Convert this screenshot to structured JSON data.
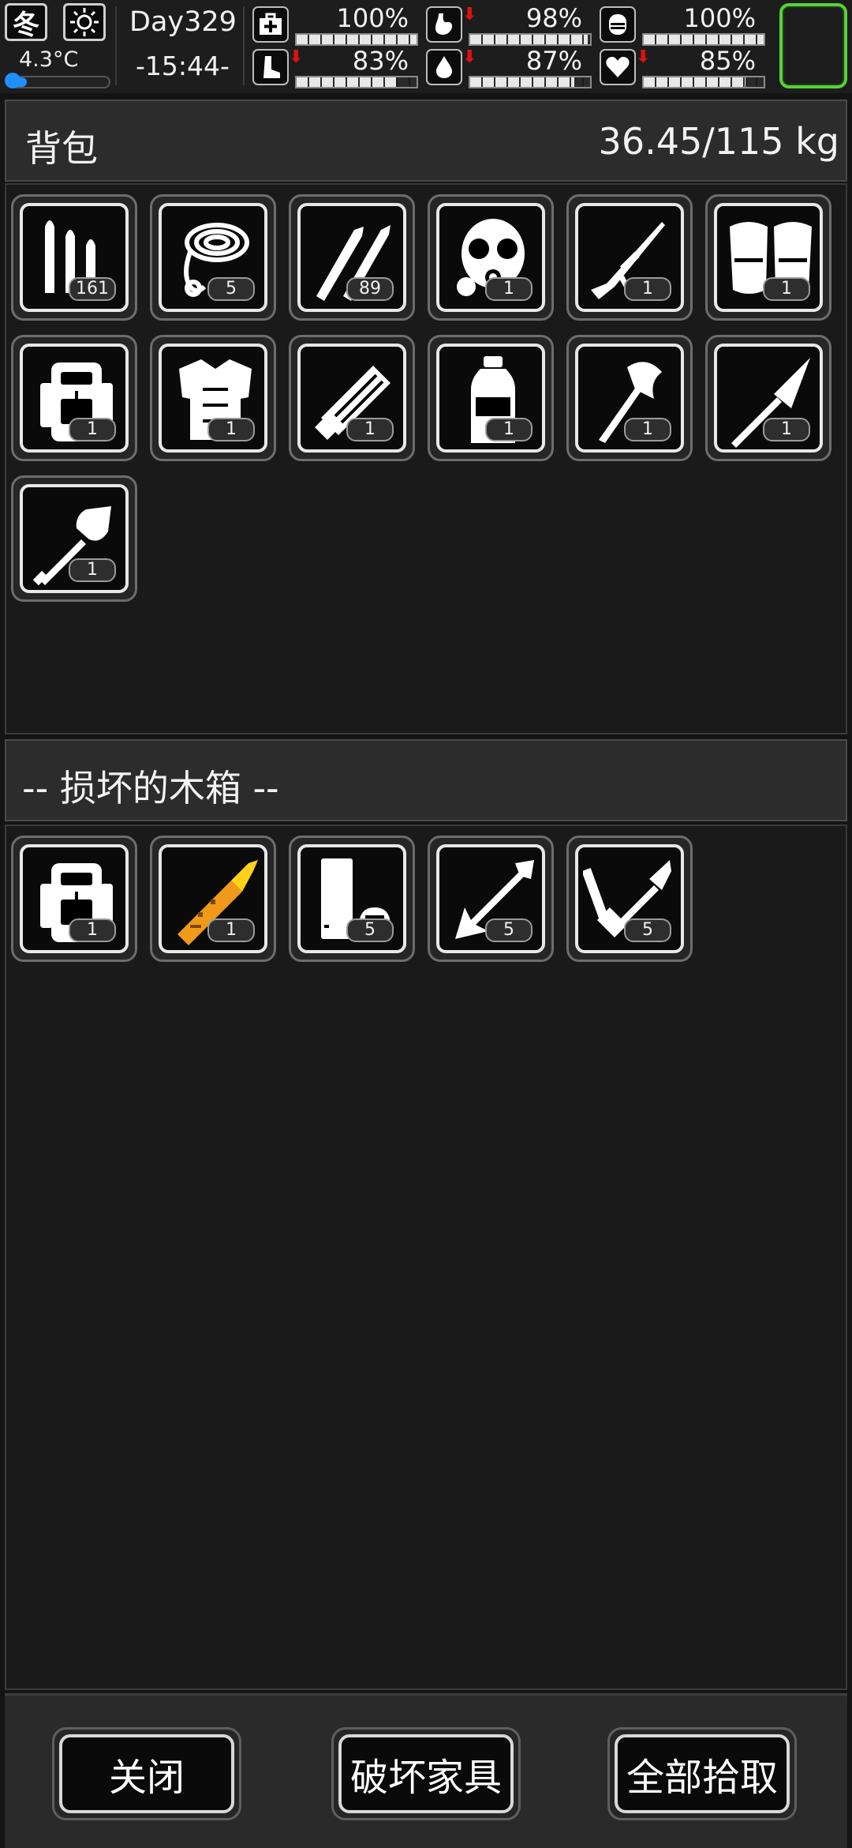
{
  "status": {
    "season": "冬",
    "weather_icon": "sun-icon",
    "temperature": "4.3°C",
    "temperature_level": 0.15,
    "day": "Day329",
    "time": "-15:44-",
    "stats": [
      {
        "icon": "medkit-icon",
        "value": "100%",
        "level": 1.0,
        "arrow": false
      },
      {
        "icon": "stomach-icon",
        "value": "98%",
        "level": 0.98,
        "arrow": true
      },
      {
        "icon": "bladder-icon",
        "value": "100%",
        "level": 1.0,
        "arrow": false
      },
      {
        "icon": "foot-icon",
        "value": "83%",
        "level": 0.83,
        "arrow": true
      },
      {
        "icon": "water-drop-icon",
        "value": "87%",
        "level": 0.87,
        "arrow": true
      },
      {
        "icon": "heart-icon",
        "value": "85%",
        "level": 0.85,
        "arrow": true
      }
    ],
    "accent_green": "#59d13a",
    "warning_red": "#e01010"
  },
  "backpack": {
    "title": "背包",
    "weight": "36.45/115 kg",
    "items": [
      {
        "icon": "bullets-icon",
        "count": "161"
      },
      {
        "icon": "rope-icon",
        "count": "5"
      },
      {
        "icon": "rifle-rounds-icon",
        "count": "89"
      },
      {
        "icon": "gas-mask-icon",
        "count": "1"
      },
      {
        "icon": "sniper-rifle-icon",
        "count": "1"
      },
      {
        "icon": "knee-pads-icon",
        "count": "1"
      },
      {
        "icon": "backpack-icon",
        "count": "1"
      },
      {
        "icon": "body-armor-icon",
        "count": "1"
      },
      {
        "icon": "minigun-icon",
        "count": "1"
      },
      {
        "icon": "water-bottle-icon",
        "count": "1"
      },
      {
        "icon": "axe-icon",
        "count": "1"
      },
      {
        "icon": "spear-icon",
        "count": "1"
      },
      {
        "icon": "shovel-icon",
        "count": "1"
      }
    ]
  },
  "container": {
    "title": "-- 损坏的木箱 --",
    "items": [
      {
        "icon": "backpack-icon",
        "count": "1"
      },
      {
        "icon": "rocket-icon",
        "count": "1"
      },
      {
        "icon": "shotgun-shells-icon",
        "count": "5"
      },
      {
        "icon": "arrow-icon",
        "count": "5"
      },
      {
        "icon": "crossbow-bolt-icon",
        "count": "5"
      }
    ]
  },
  "footer": {
    "close_label": "关闭",
    "destroy_label": "破坏家具",
    "take_all_label": "全部拾取"
  }
}
